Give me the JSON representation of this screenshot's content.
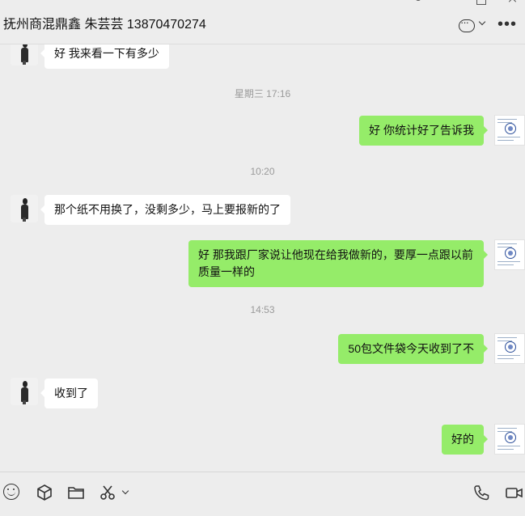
{
  "header": {
    "title": "抚州商混鼎鑫 朱芸芸 13870470274"
  },
  "messages": [
    {
      "type": "in",
      "text": "好 我来看一下有多少"
    },
    {
      "type": "time",
      "text": "星期三 17:16"
    },
    {
      "type": "out",
      "text": "好 你统计好了告诉我"
    },
    {
      "type": "time",
      "text": "10:20"
    },
    {
      "type": "in",
      "text": "那个纸不用换了，没剩多少，马上要报新的了"
    },
    {
      "type": "out",
      "text": "好 那我跟厂家说让他现在给我做新的，要厚一点跟以前质量一样的"
    },
    {
      "type": "time",
      "text": "14:53"
    },
    {
      "type": "out",
      "text": "50包文件袋今天收到了不"
    },
    {
      "type": "in",
      "text": "收到了"
    },
    {
      "type": "out",
      "text": "好的"
    }
  ],
  "icons": {
    "header": [
      "chat-bubble-icon",
      "chevron-down-icon",
      "more-icon"
    ],
    "toolbar": [
      "emoji-icon",
      "cube-icon",
      "folder-icon",
      "scissors-icon",
      "chevron-down-icon",
      "phone-icon",
      "video-icon"
    ]
  },
  "colors": {
    "background": "#ededed",
    "outgoing_bubble": "#95ec69",
    "incoming_bubble": "#ffffff",
    "timestamp_text": "#9a9a9a"
  }
}
